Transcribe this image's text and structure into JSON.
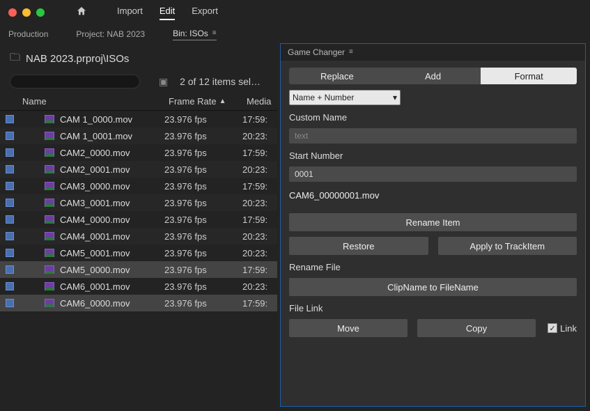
{
  "menu": {
    "import": "Import",
    "edit": "Edit",
    "export": "Export",
    "active": "edit"
  },
  "crumbs": {
    "production": "Production",
    "project": "Project: NAB 2023",
    "bin": "Bin: ISOs"
  },
  "project": {
    "path": "NAB 2023.prproj\\ISOs",
    "selection_info": "2 of 12 items sel…",
    "columns": {
      "name": "Name",
      "frame_rate": "Frame Rate",
      "media": "Media"
    },
    "rows": [
      {
        "name": "CAM 1_0000.mov",
        "fr": "23.976 fps",
        "media": "17:59:",
        "selected": false
      },
      {
        "name": "CAM 1_0001.mov",
        "fr": "23.976 fps",
        "media": "20:23:",
        "selected": false
      },
      {
        "name": "CAM2_0000.mov",
        "fr": "23.976 fps",
        "media": "17:59:",
        "selected": false
      },
      {
        "name": "CAM2_0001.mov",
        "fr": "23.976 fps",
        "media": "20:23:",
        "selected": false
      },
      {
        "name": "CAM3_0000.mov",
        "fr": "23.976 fps",
        "media": "17:59:",
        "selected": false
      },
      {
        "name": "CAM3_0001.mov",
        "fr": "23.976 fps",
        "media": "20:23:",
        "selected": false
      },
      {
        "name": "CAM4_0000.mov",
        "fr": "23.976 fps",
        "media": "17:59:",
        "selected": false
      },
      {
        "name": "CAM4_0001.mov",
        "fr": "23.976 fps",
        "media": "20:23:",
        "selected": false
      },
      {
        "name": "CAM5_0001.mov",
        "fr": "23.976 fps",
        "media": "20:23:",
        "selected": false
      },
      {
        "name": "CAM5_0000.mov",
        "fr": "23.976 fps",
        "media": "17:59:",
        "selected": true
      },
      {
        "name": "CAM6_0001.mov",
        "fr": "23.976 fps",
        "media": "20:23:",
        "selected": false
      },
      {
        "name": "CAM6_0000.mov",
        "fr": "23.976 fps",
        "media": "17:59:",
        "selected": true
      }
    ]
  },
  "panel": {
    "title": "Game Changer",
    "tabs": {
      "replace": "Replace",
      "add": "Add",
      "format": "Format",
      "active": "format"
    },
    "format_mode": "Name + Number",
    "custom_name_label": "Custom Name",
    "custom_name_placeholder": "text",
    "custom_name_value": "",
    "start_number_label": "Start Number",
    "start_number_value": "0001",
    "preview": "CAM6_00000001.mov",
    "rename_item": "Rename Item",
    "restore": "Restore",
    "apply_trackitem": "Apply to TrackItem",
    "rename_file_label": "Rename File",
    "clip_to_file": "ClipName to FileName",
    "file_link_label": "File Link",
    "move": "Move",
    "copy": "Copy",
    "link_label": "Link",
    "link_checked": true
  }
}
